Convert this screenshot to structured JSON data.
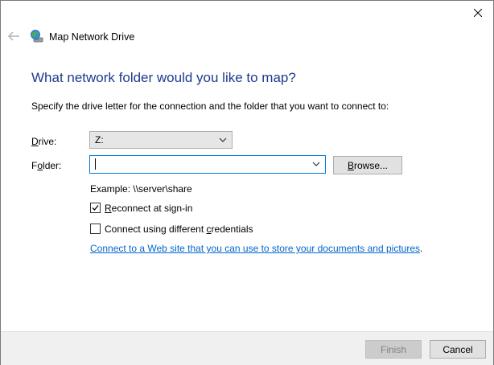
{
  "window": {
    "title": "Map Network Drive",
    "icons": {
      "back": "back-arrow-icon",
      "app": "network-drive-icon",
      "close": "close-icon"
    }
  },
  "content": {
    "heading": "What network folder would you like to map?",
    "description": "Specify the drive letter for the connection and the folder that you want to connect to:",
    "drive": {
      "label_accel": "D",
      "label_rest": "rive:",
      "value": "Z:"
    },
    "folder": {
      "label_pre": "F",
      "label_accel": "o",
      "label_rest": "lder:",
      "value": "",
      "browse_accel": "B",
      "browse_rest": "rowse..."
    },
    "example": "Example: \\\\server\\share",
    "reconnect": {
      "label_accel": "R",
      "label_rest": "econnect at sign-in",
      "checked": true
    },
    "credentials": {
      "label_pre": "Connect using different ",
      "label_accel": "c",
      "label_rest": "redentials",
      "checked": false
    },
    "link": "Connect to a Web site that you can use to store your documents and pictures",
    "link_suffix": "."
  },
  "footer": {
    "finish_label": "Finish",
    "cancel_label": "Cancel"
  },
  "colors": {
    "heading": "#1e3b8f",
    "link": "#0066cc",
    "focus_border": "#0078d7"
  }
}
